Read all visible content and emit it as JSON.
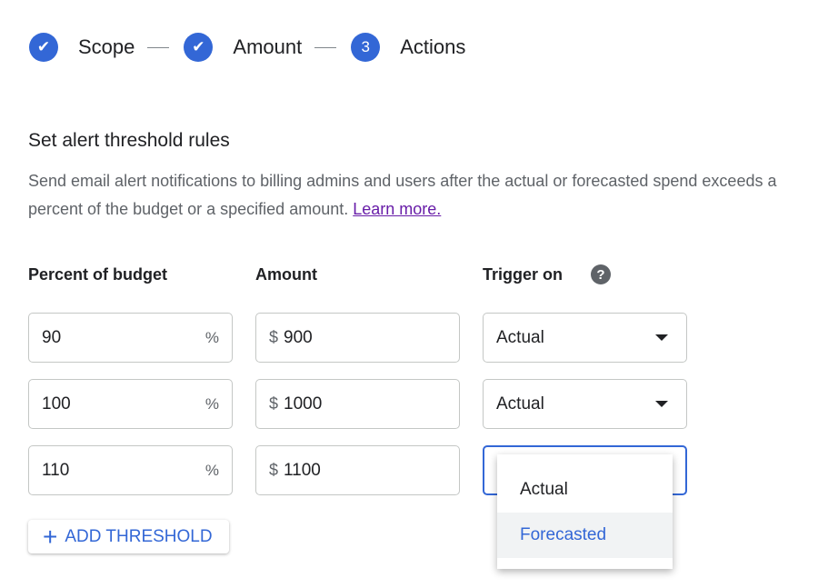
{
  "stepper": {
    "steps": [
      {
        "label": "Scope",
        "state": "done",
        "icon": "check-icon"
      },
      {
        "label": "Amount",
        "state": "done",
        "icon": "check-icon"
      },
      {
        "label": "Actions",
        "number": "3",
        "state": "current"
      }
    ]
  },
  "section": {
    "title": "Set alert threshold rules",
    "description": "Send email alert notifications to billing admins and users after the actual or forecasted spend exceeds a percent of the budget or a specified amount.",
    "learn_more": "Learn more."
  },
  "columns": {
    "percent": "Percent of budget",
    "amount": "Amount",
    "trigger": "Trigger on",
    "help_icon": "?"
  },
  "rows": [
    {
      "percent": "90",
      "percent_suffix": "%",
      "currency": "$",
      "amount": "900",
      "trigger": "Actual"
    },
    {
      "percent": "100",
      "percent_suffix": "%",
      "currency": "$",
      "amount": "1000",
      "trigger": "Actual"
    },
    {
      "percent": "110",
      "percent_suffix": "%",
      "currency": "$",
      "amount": "1100",
      "trigger": ""
    }
  ],
  "add_threshold": {
    "icon": "+",
    "label": "ADD THRESHOLD"
  },
  "dropdown": {
    "options": [
      "Actual",
      "Forecasted"
    ],
    "highlighted": "Forecasted"
  },
  "colors": {
    "accent": "#3367d6",
    "link": "#681da8"
  }
}
